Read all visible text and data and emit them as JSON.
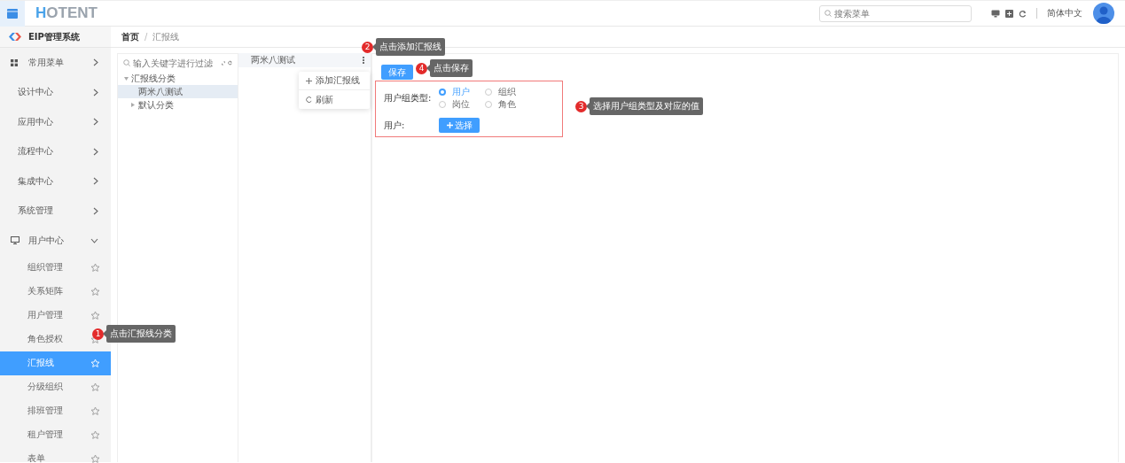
{
  "header": {
    "logo": "HOTENT",
    "search": {
      "placeholder": "搜索菜单"
    },
    "language": "简体中文"
  },
  "sidebar": {
    "title": "EIP管理系统",
    "items": [
      {
        "label": "常用菜单",
        "kind": "shortcut",
        "expanded": false
      },
      {
        "label": "设计中心",
        "expanded": false
      },
      {
        "label": "应用中心",
        "expanded": false
      },
      {
        "label": "流程中心",
        "expanded": false
      },
      {
        "label": "集成中心",
        "expanded": false
      },
      {
        "label": "系统管理",
        "expanded": false
      },
      {
        "label": "用户中心",
        "kind": "user",
        "expanded": true,
        "children": [
          {
            "label": "组织管理",
            "selected": false
          },
          {
            "label": "关系矩阵",
            "selected": false
          },
          {
            "label": "用户管理",
            "selected": false
          },
          {
            "label": "角色授权",
            "selected": false
          },
          {
            "label": "汇报线",
            "selected": true
          },
          {
            "label": "分级组织",
            "selected": false
          },
          {
            "label": "排班管理",
            "selected": false
          },
          {
            "label": "租户管理",
            "selected": false
          },
          {
            "label": "表单",
            "selected": false
          }
        ]
      }
    ]
  },
  "breadcrumb": {
    "separator": "/",
    "items": [
      {
        "label": "首页",
        "current": false
      },
      {
        "label": "汇报线",
        "current": true
      }
    ]
  },
  "tree": {
    "placeholder": "输入关键字进行过滤",
    "nodes": [
      {
        "label": "汇报线分类",
        "kind": "branch",
        "expanded": true,
        "selected": false,
        "children": [
          {
            "label": "两米八测试",
            "kind": "leaf",
            "expanded": false,
            "selected": true
          },
          {
            "label": "默认分类",
            "kind": "branch",
            "expanded": false,
            "selected": false
          }
        ]
      }
    ]
  },
  "list": {
    "items": [
      {
        "label": "两米八测试"
      }
    ],
    "menu": [
      {
        "label": "添加汇报线"
      },
      {
        "label": "刷新"
      }
    ]
  },
  "form": {
    "save": "保存",
    "group_type_label": "用户组类型:",
    "options": [
      {
        "label": "用户",
        "selected": true
      },
      {
        "label": "组织",
        "selected": false
      },
      {
        "label": "岗位",
        "selected": false
      },
      {
        "label": "角色",
        "selected": false
      }
    ],
    "user_label": "用户:",
    "choose": "选择"
  },
  "callouts": [
    {
      "number": "1",
      "text": "点击汇报线分类"
    },
    {
      "number": "2",
      "text": "点击添加汇报线"
    },
    {
      "number": "4",
      "text": "点击保存"
    },
    {
      "number": "3",
      "text": "选择用户组类型及对应的值"
    }
  ]
}
